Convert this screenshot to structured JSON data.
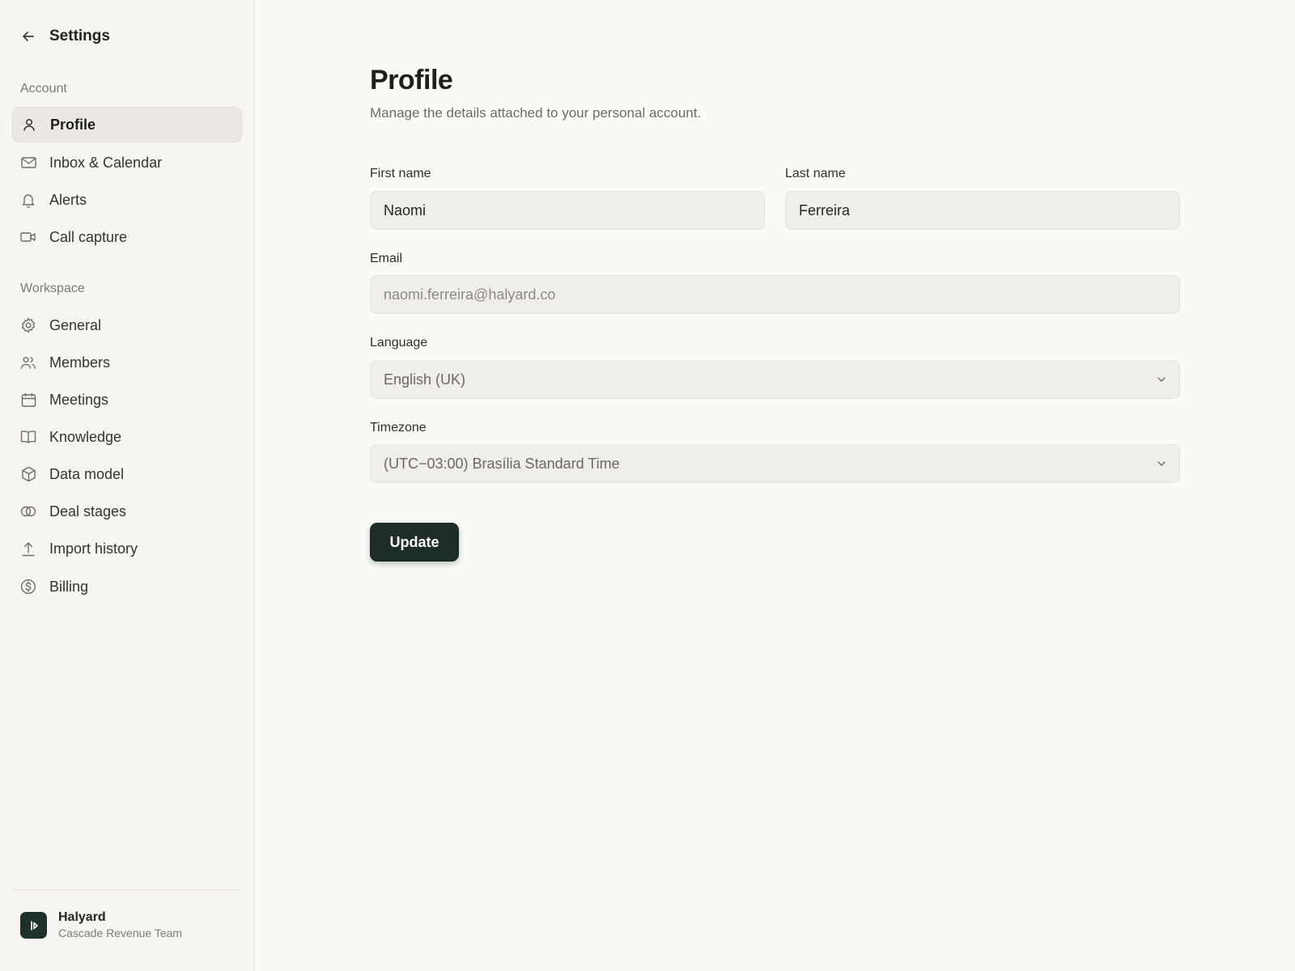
{
  "sidebar": {
    "title": "Settings",
    "account_label": "Account",
    "workspace_label": "Workspace",
    "account_items": [
      {
        "label": "Profile",
        "icon": "user-icon",
        "active": true
      },
      {
        "label": "Inbox & Calendar",
        "icon": "mail-icon"
      },
      {
        "label": "Alerts",
        "icon": "bell-icon"
      },
      {
        "label": "Call capture",
        "icon": "video-icon"
      }
    ],
    "workspace_items": [
      {
        "label": "General",
        "icon": "gear-icon"
      },
      {
        "label": "Members",
        "icon": "users-icon"
      },
      {
        "label": "Meetings",
        "icon": "calendar-icon"
      },
      {
        "label": "Knowledge",
        "icon": "book-icon"
      },
      {
        "label": "Data model",
        "icon": "cube-icon"
      },
      {
        "label": "Deal stages",
        "icon": "rings-icon"
      },
      {
        "label": "Import history",
        "icon": "upload-icon"
      },
      {
        "label": "Billing",
        "icon": "dollar-icon"
      }
    ],
    "workspace": {
      "name": "Halyard",
      "team": "Cascade Revenue Team",
      "logo_color": "#1d3029"
    }
  },
  "main": {
    "title": "Profile",
    "subtitle": "Manage the details attached to your personal account.",
    "first_name": {
      "label": "First name",
      "value": "Naomi"
    },
    "last_name": {
      "label": "Last name",
      "value": "Ferreira"
    },
    "email": {
      "label": "Email",
      "value": "naomi.ferreira@halyard.co"
    },
    "language": {
      "label": "Language",
      "value": "English (UK)"
    },
    "timezone": {
      "label": "Timezone",
      "value": "(UTC−03:00) Brasília Standard Time"
    },
    "update_label": "Update"
  },
  "colors": {
    "accent": "#1e2d27",
    "active_nav_bg": "#ebe9e2",
    "field_bg": "#f0eee8"
  }
}
